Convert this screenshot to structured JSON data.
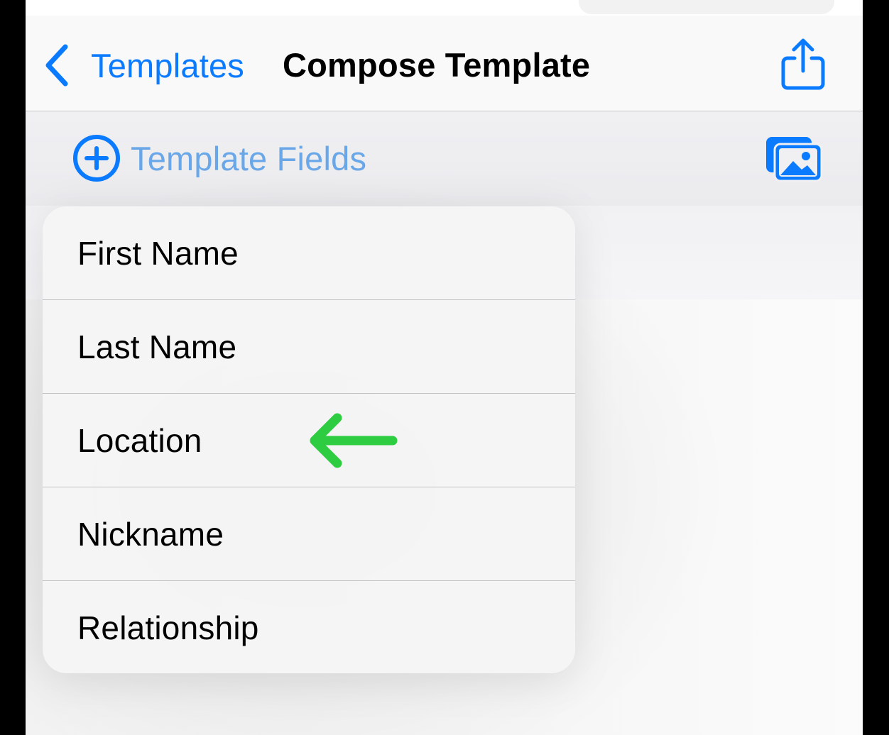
{
  "nav_bar": {
    "back_label": "Templates",
    "title": "Compose Template",
    "back_icon": "chevron-left-icon",
    "share_icon": "share-icon"
  },
  "toolbar": {
    "template_fields_label": "Template Fields",
    "template_fields_icon": "plus-circle-icon",
    "photos_icon": "photos-icon"
  },
  "menu": {
    "items": [
      {
        "label": "First Name"
      },
      {
        "label": "Last Name"
      },
      {
        "label": "Location"
      },
      {
        "label": "Nickname"
      },
      {
        "label": "Relationship"
      }
    ]
  },
  "annotation": {
    "icon": "left-arrow-icon",
    "points_to": "Location",
    "color": "#2ecc40"
  },
  "colors": {
    "accent": "#0a7aff",
    "accent_muted": "#6aa7e8",
    "annotation": "#2ecc40"
  }
}
